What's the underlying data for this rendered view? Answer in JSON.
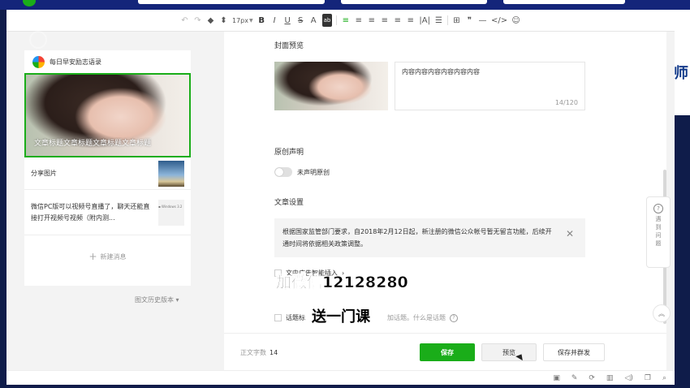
{
  "toolbar": {
    "font_size": "17px",
    "items": [
      "↶",
      "↷",
      "◆",
      "⬍",
      "B",
      "I",
      "U",
      "S",
      "A",
      "ab",
      "≡",
      "≡",
      "≡",
      "≡",
      "≡",
      "≡",
      "|A|",
      "☰",
      "⊞",
      "❞",
      "—",
      "</>",
      "☺"
    ]
  },
  "sidebar": {
    "account_name": "每日早安励志语录",
    "cover_title": "文章标题文章标题文章标题文章标题",
    "items": [
      {
        "title": "分享图片"
      },
      {
        "title": "微信PC版可以视频号直播了，聊天还能直接打开视频号视频（附内测...",
        "thumb_text": "▪ Windows 3.2"
      }
    ],
    "new_message": "新建消息",
    "history": "图文历史版本"
  },
  "editor": {
    "cover_label": "封面预览",
    "digest_text": "内容内容内容内容内容内容",
    "digest_count": "14/120",
    "original_label": "原创声明",
    "original_toggle": "未声明原创",
    "settings_label": "文章设置",
    "notice_text": "根据国家监管部门要求，自2018年2月12日起，新注册的微信公众帐号暂无留言功能，后续开通时间将依据相关政策调整。",
    "ad_label": "文中广告智能插入",
    "topic_label": "话题标",
    "topic_tail": "加话题。什么是话题"
  },
  "bottom": {
    "word_count_label": "正文字数",
    "word_count_value": "14",
    "save": "保存",
    "preview": "预览",
    "save_mass": "保存并群发"
  },
  "help": {
    "label": "遇到问题"
  },
  "overlay": {
    "line1": "加微信12128280",
    "line2": "送一门课"
  },
  "brand": {
    "edge_char": "师"
  },
  "colors": {
    "accent": "#1aad19"
  }
}
